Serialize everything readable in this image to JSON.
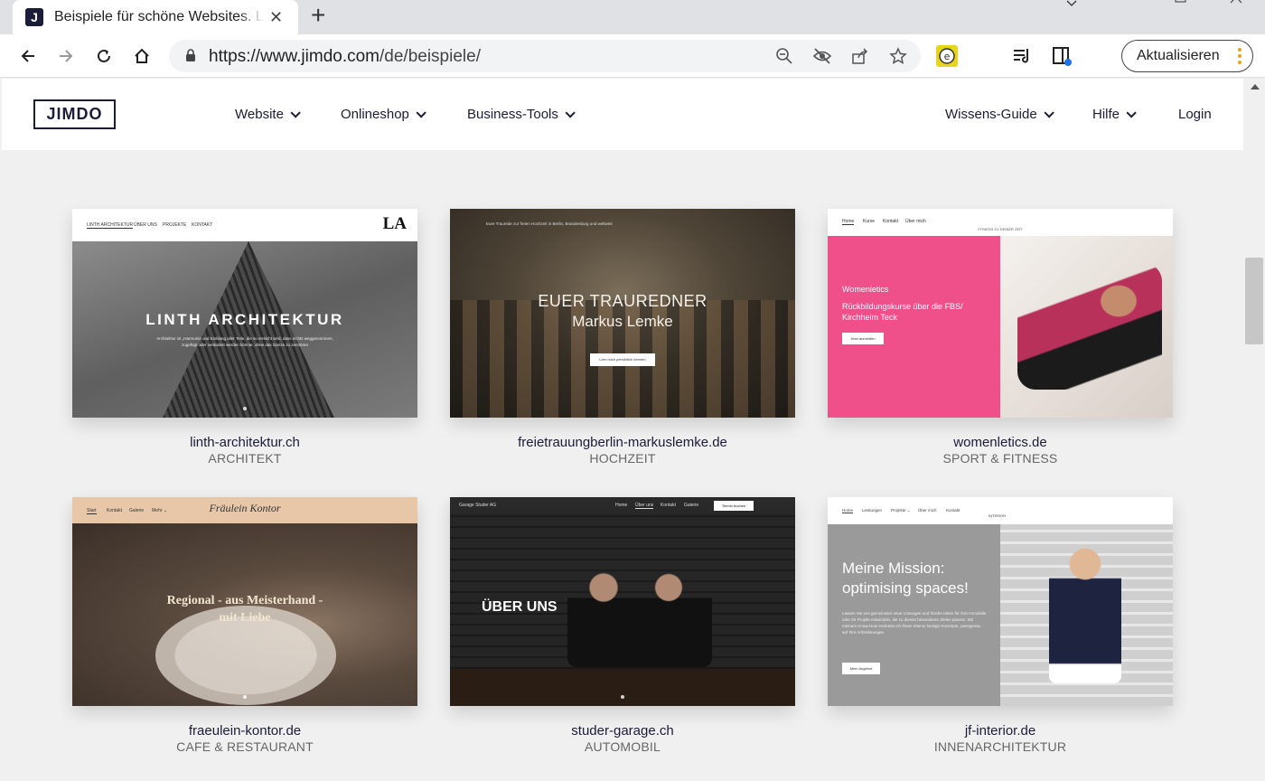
{
  "browser": {
    "tab_title": "Beispiele für schöne Websites. Lassen Sie sich inspirieren",
    "tab_icon_letter": "J",
    "url_host": "https://www.jimdo.com",
    "url_path": "/de/beispiele/",
    "update_label": "Aktualisieren"
  },
  "header": {
    "logo": "JIMDO",
    "nav_left": [
      "Website",
      "Onlineshop",
      "Business-Tools"
    ],
    "nav_right": [
      "Wissens-Guide",
      "Hilfe"
    ],
    "login": "Login"
  },
  "cards": [
    {
      "domain": "linth-architektur.ch",
      "category": "ARCHITEKT",
      "preview": {
        "nav": [
          "LINTH ARCHITEKTUR",
          "ÜBER UNS",
          "PROJEKTE",
          "KONTAKT"
        ],
        "logo": "LA",
        "title": "LINTH ARCHITEKTUR",
        "subtitle": "Architektur ist „Harmonie und Einklang aller Teile, die so erreicht wird, dass nichts weggenommen, zugefügt oder verändert werden könnte, ohne das Ganze zu zerstören"
      }
    },
    {
      "domain": "freietrauungberlin-markuslemke.de",
      "category": "HOCHZEIT",
      "preview": {
        "topline": "Eure Traurede zur freien Hochzeit in Berlin, Brandenburg und weltweit",
        "title": "EUER TRAUREDNER",
        "name": "Markus Lemke",
        "button": "Lern mich persönlich kennen"
      }
    },
    {
      "domain": "womenletics.de",
      "category": "SPORT & FITNESS",
      "preview": {
        "nav": [
          "Home",
          "Kurse",
          "Kontakt",
          "Über mich"
        ],
        "tagline": "FITNESS ZU DEINER ZEIT",
        "brand": "Womenletics",
        "text": "Rückbildungskurse über die FBS/ Kirchheim Teck",
        "button": "Jetzt anmelden"
      }
    },
    {
      "domain": "fraeulein-kontor.de",
      "category": "CAFE & RESTAURANT",
      "preview": {
        "nav": [
          "Start",
          "Kontakt",
          "Galerie",
          "Mehr ⌄"
        ],
        "logo": "Fräulein Kontor",
        "title_line1": "Regional - aus Meisterhand -",
        "title_line2": "mit Liebe"
      }
    },
    {
      "domain": "studer-garage.ch",
      "category": "AUTOMOBIL",
      "preview": {
        "brand": "Garage Studer AG",
        "nav": [
          "Home",
          "Über uns",
          "Kontakt",
          "Galerie"
        ],
        "button": "Termin buchen",
        "title": "ÜBER UNS"
      }
    },
    {
      "domain": "jf-interior.de",
      "category": "INNENARCHITEKTUR",
      "preview": {
        "nav": [
          "Home",
          "Leistungen",
          "Projekte ⌄",
          "Über mich",
          "Kontakt"
        ],
        "logo": "INTERIOR",
        "title_line1": "Meine Mission:",
        "title_line2": "optimising spaces!",
        "text": "Lassen Sie uns gemeinsam neue Lösungen und frische Ideen für Ihre Immobilie oder Ihr Projekt entwickeln, die zu diesen besonderen Zielen passen. Mit meinem Know-How erarbeite ich Ihnen Interior Design-Konzepte, passgenau auf Ihre Anforderungen.",
        "button": "Mein Angebot"
      }
    }
  ],
  "colors": {
    "brand_navy": "#1b1b3a",
    "page_bg": "#f0f0f0",
    "womenletics_pink": "#f0508a",
    "update_dots": "#e8a317"
  },
  "icons": [
    "back-icon",
    "forward-icon",
    "reload-icon",
    "home-icon",
    "lock-icon",
    "zoom-icon",
    "eye-off-icon",
    "share-icon",
    "star-icon",
    "extension-icon",
    "media-icon",
    "profile-icon",
    "chevron-down-icon"
  ]
}
